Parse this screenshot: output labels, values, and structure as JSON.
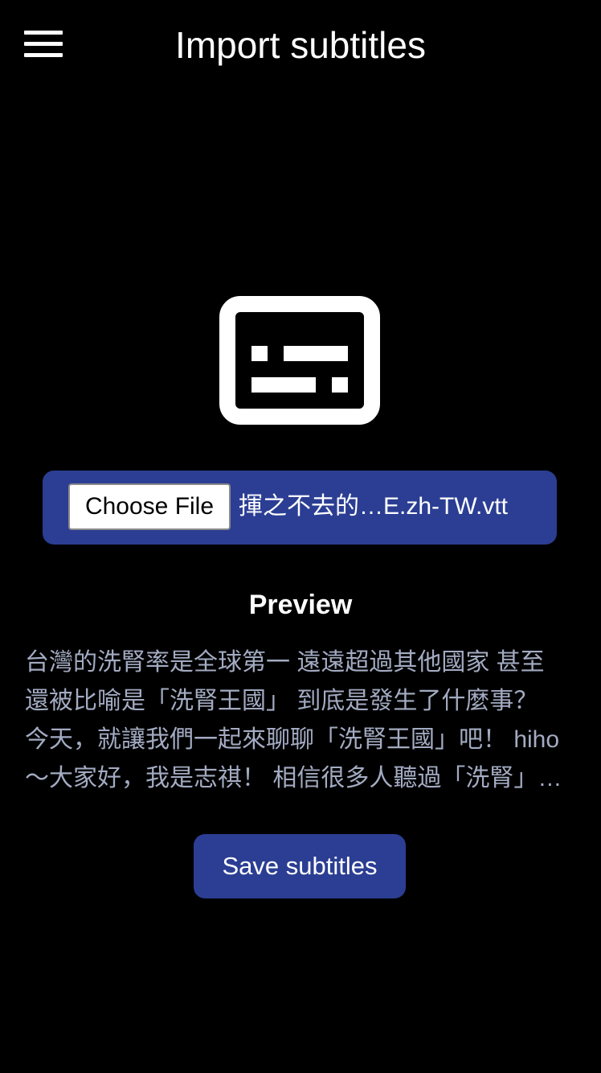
{
  "header": {
    "title": "Import subtitles",
    "menu_icon": "hamburger-menu-icon"
  },
  "main": {
    "hero_icon": "subtitles-icon",
    "file_input": {
      "button_label": "Choose File",
      "selected_file": "揮之不去的…E.zh-TW.vtt"
    },
    "preview": {
      "heading": "Preview",
      "text": "台灣的洗腎率是全球第一 遠遠超過其他國家 甚至還被比喻是「洗腎王國」 到底是發生了什麼事？ 今天，就讓我們一起來聊聊「洗腎王國」吧！ hiho～大家好，我是志祺！ 相信很多人聽過「洗腎」這個名詞"
    },
    "save_label": "Save subtitles"
  },
  "colors": {
    "background": "#000000",
    "accent": "#2b3e93",
    "preview_text": "#a3abc2",
    "text": "#ffffff"
  }
}
